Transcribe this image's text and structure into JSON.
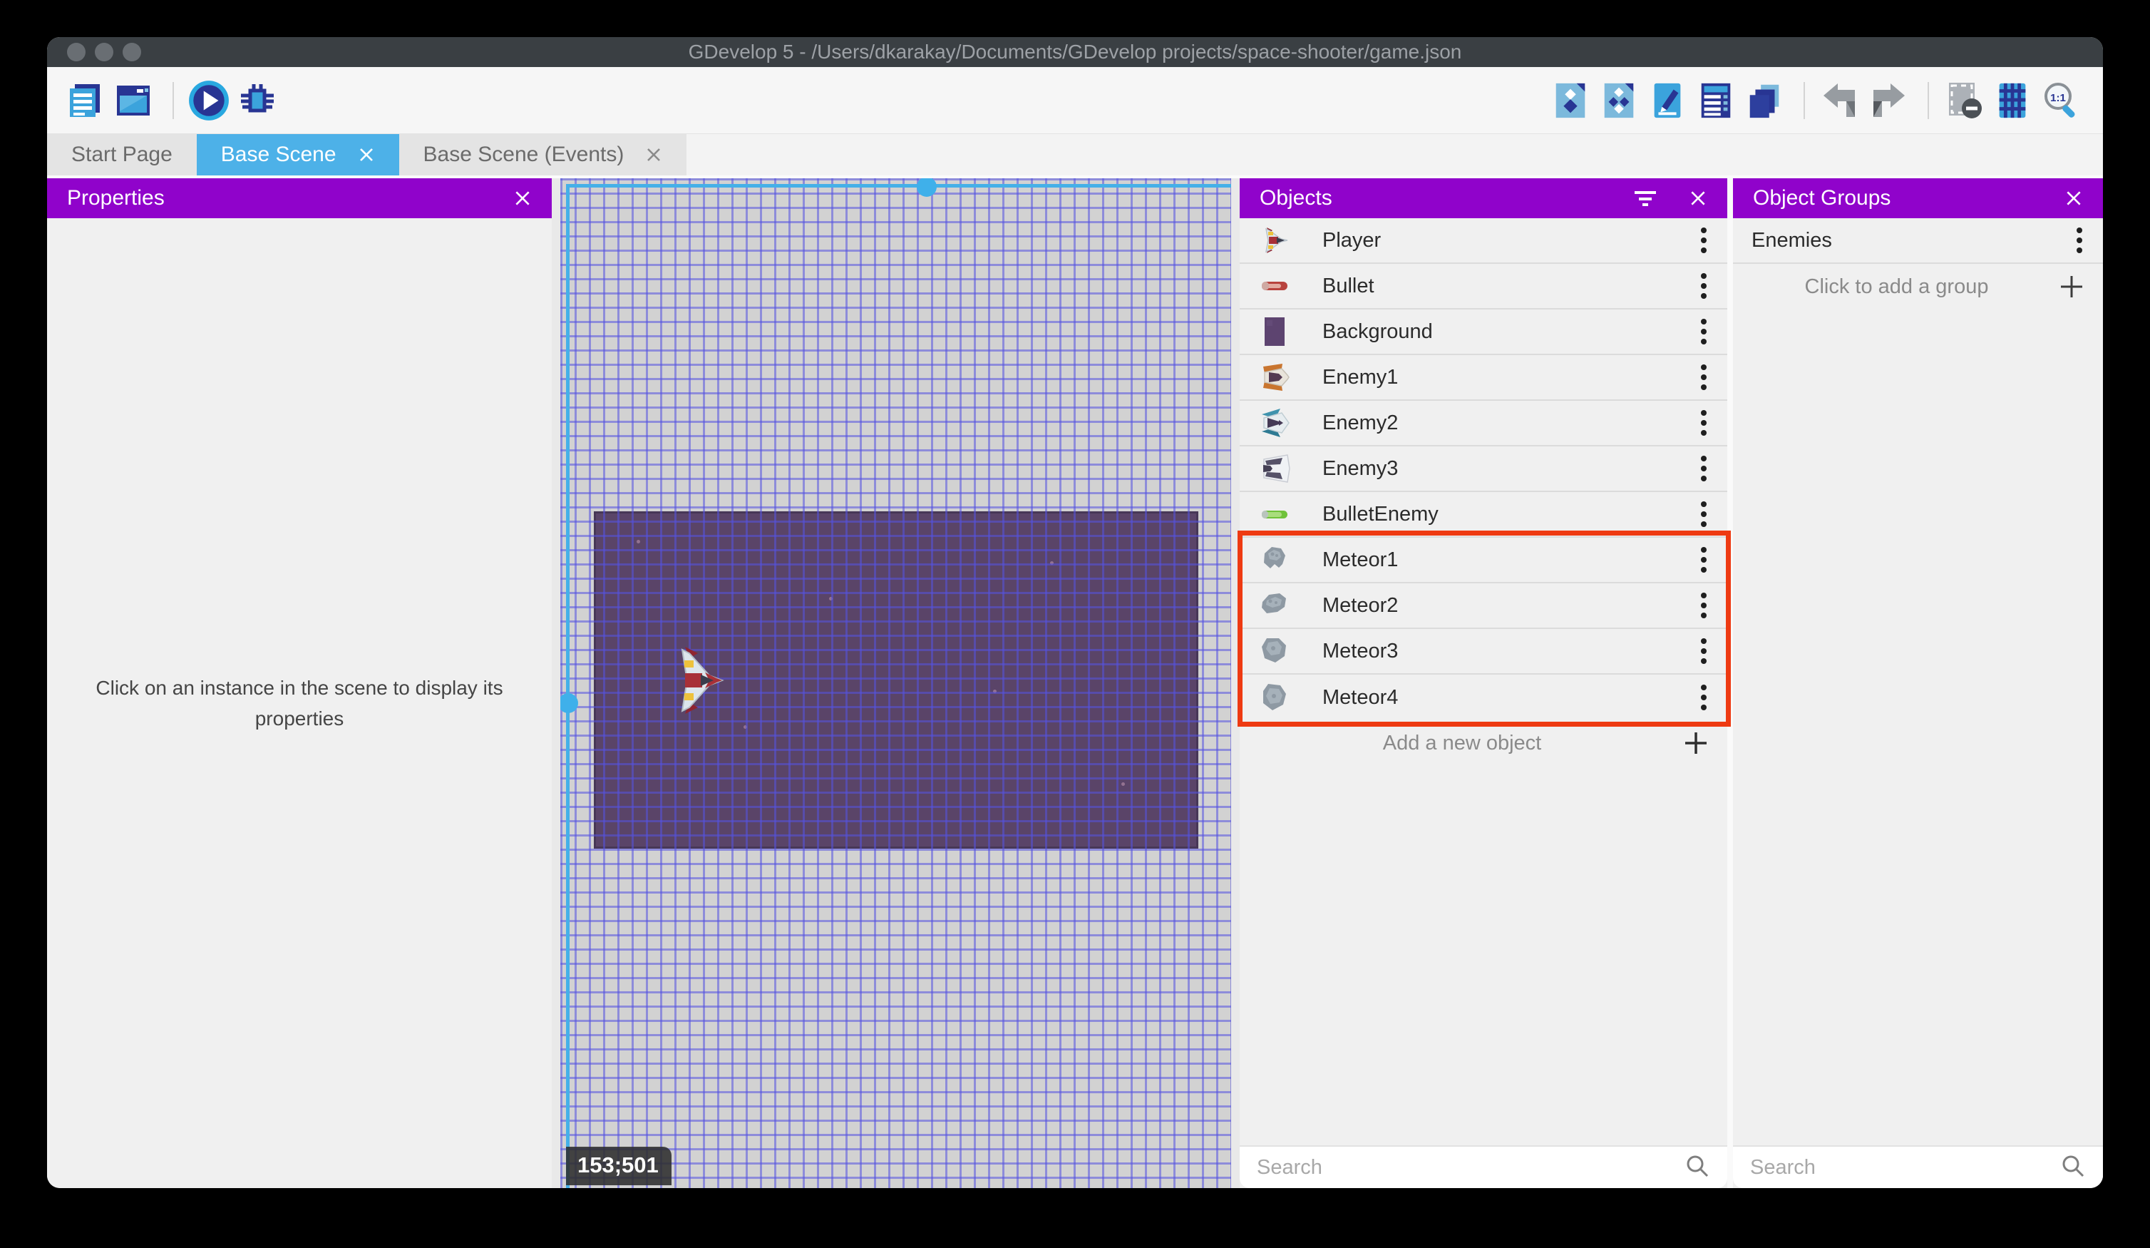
{
  "window": {
    "title": "GDevelop 5 - /Users/dkarakay/Documents/GDevelop projects/space-shooter/game.json"
  },
  "toolbar": {
    "left_icons": [
      "project-manager-icon",
      "scene-window-icon",
      "play-icon",
      "debug-icon"
    ],
    "right_icons": [
      "add-object-icon",
      "instances-icon",
      "edit-properties-icon",
      "objects-list-icon",
      "layers-icon",
      "undo-icon",
      "redo-icon",
      "toggle-mask-icon",
      "toggle-grid-icon",
      "zoom-1-1-icon"
    ]
  },
  "tabs": {
    "start_page": "Start Page",
    "base_scene": "Base Scene",
    "base_scene_events": "Base Scene (Events)"
  },
  "properties_panel": {
    "title": "Properties",
    "empty_message": "Click on an instance in the scene to display its properties"
  },
  "scene": {
    "cursor_coordinates": "153;501"
  },
  "objects_panel": {
    "title": "Objects",
    "items": [
      {
        "label": "Player",
        "icon": "player-ship-icon"
      },
      {
        "label": "Bullet",
        "icon": "bullet-icon"
      },
      {
        "label": "Background",
        "icon": "background-swatch-icon"
      },
      {
        "label": "Enemy1",
        "icon": "enemy1-ship-icon"
      },
      {
        "label": "Enemy2",
        "icon": "enemy2-ship-icon"
      },
      {
        "label": "Enemy3",
        "icon": "enemy3-ship-icon"
      },
      {
        "label": "BulletEnemy",
        "icon": "enemy-bullet-icon"
      },
      {
        "label": "Meteor1",
        "icon": "meteor-icon"
      },
      {
        "label": "Meteor2",
        "icon": "meteor-icon"
      },
      {
        "label": "Meteor3",
        "icon": "meteor-icon"
      },
      {
        "label": "Meteor4",
        "icon": "meteor-icon"
      }
    ],
    "highlighted_items": [
      "Meteor1",
      "Meteor2",
      "Meteor3",
      "Meteor4"
    ],
    "add_button_label": "Add a new object",
    "search_placeholder": "Search"
  },
  "object_groups_panel": {
    "title": "Object Groups",
    "groups": [
      {
        "label": "Enemies"
      }
    ],
    "add_button_label": "Click to add a group",
    "search_placeholder": "Search"
  },
  "colors": {
    "accent_purple": "#9003cb",
    "active_tab_blue": "#4db1e8",
    "selection_cyan": "#45b0e8",
    "highlight_red": "#ee3a12",
    "scene_background_purple": "#5a4468",
    "titlebar_gray": "#3a3f43"
  }
}
